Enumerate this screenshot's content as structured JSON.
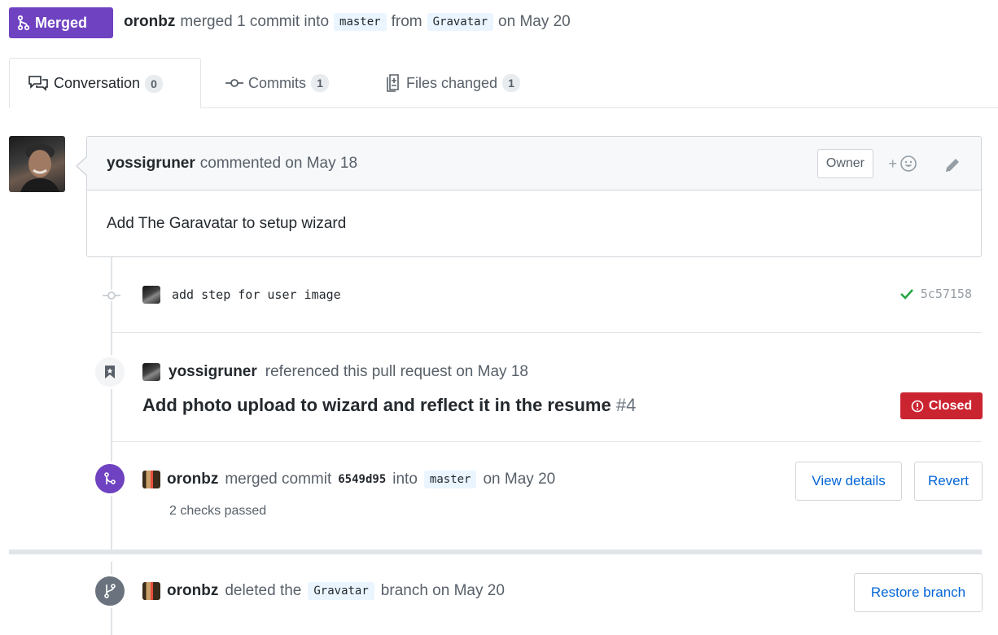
{
  "header": {
    "status_label": "Merged",
    "author": "oronbz",
    "action_text": "merged 1 commit into",
    "base_branch": "master",
    "from_text": "from",
    "head_branch": "Gravatar",
    "date_text": "on May 20"
  },
  "tabs": [
    {
      "label": "Conversation",
      "count": "0"
    },
    {
      "label": "Commits",
      "count": "1"
    },
    {
      "label": "Files changed",
      "count": "1"
    }
  ],
  "comment": {
    "author": "yossigruner",
    "action": "commented on May 18",
    "owner_label": "Owner",
    "reaction_label": "+",
    "body": "Add The Garavatar to setup wizard"
  },
  "commit": {
    "message": "add step for user image",
    "sha": "5c57158"
  },
  "reference": {
    "author": "yossigruner",
    "action": "referenced this pull request on May 18",
    "title": "Add photo upload to wizard and reflect it in the resume",
    "number": "#4",
    "state": "Closed"
  },
  "merge_event": {
    "author": "oronbz",
    "action": "merged commit",
    "sha": "6549d95",
    "into_text": "into",
    "branch": "master",
    "date_text": "on May 20",
    "checks": "2 checks passed",
    "view_details_label": "View details",
    "revert_label": "Revert"
  },
  "delete_event": {
    "author": "oronbz",
    "action": "deleted the",
    "branch": "Gravatar",
    "after_text": "branch on May 20",
    "restore_label": "Restore branch"
  },
  "colors": {
    "merged": "#6f42c1",
    "closed": "#cb2431",
    "link": "#0366d6",
    "success": "#28a745"
  }
}
